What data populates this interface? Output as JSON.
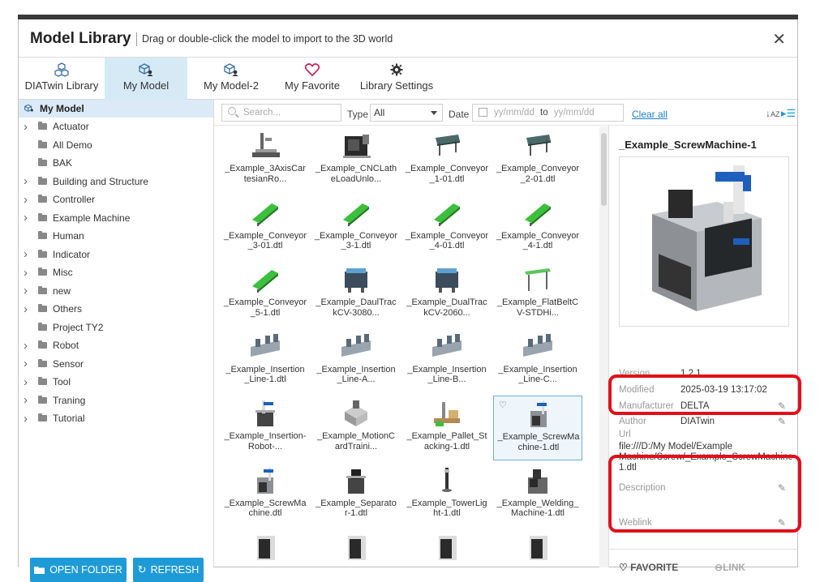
{
  "window": {
    "title": "Model Library",
    "subtitle": "Drag or double-click the model to import to the 3D world",
    "close_label": "✕"
  },
  "tabs": [
    {
      "label": "DIATwin Library",
      "icon": "cubes-icon"
    },
    {
      "label": "My Model",
      "icon": "cube-user-icon"
    },
    {
      "label": "My Model-2",
      "icon": "cube-user-icon"
    },
    {
      "label": "My Favorite",
      "icon": "heart-icon"
    },
    {
      "label": "Library Settings",
      "icon": "gear-icon"
    }
  ],
  "sidebar": {
    "root_label": "My Model",
    "items": [
      {
        "label": "Actuator",
        "expandable": true
      },
      {
        "label": "All Demo",
        "expandable": false
      },
      {
        "label": "BAK",
        "expandable": false
      },
      {
        "label": "Building and Structure",
        "expandable": true
      },
      {
        "label": "Controller",
        "expandable": true
      },
      {
        "label": "Example Machine",
        "expandable": true
      },
      {
        "label": "Human",
        "expandable": false
      },
      {
        "label": "Indicator",
        "expandable": true
      },
      {
        "label": "Misc",
        "expandable": true
      },
      {
        "label": "new",
        "expandable": true
      },
      {
        "label": "Others",
        "expandable": true
      },
      {
        "label": "Project TY2",
        "expandable": false
      },
      {
        "label": "Robot",
        "expandable": true
      },
      {
        "label": "Sensor",
        "expandable": true
      },
      {
        "label": "Tool",
        "expandable": true
      },
      {
        "label": "Traning",
        "expandable": true
      },
      {
        "label": "Tutorial",
        "expandable": true
      }
    ],
    "open_folder_label": "OPEN FOLDER",
    "refresh_label": "REFRESH"
  },
  "toolbar": {
    "search_placeholder": "Search...",
    "type_label": "Type",
    "type_value": "All",
    "date_label": "Date",
    "date_from_placeholder": "yy/mm/dd",
    "date_to_label": "to",
    "date_to_placeholder": "yy/mm/dd",
    "clear_all_label": "Clear all",
    "sort_label": "↓A Z"
  },
  "models": [
    {
      "name": "_Example_3AxisCartesianRo...",
      "line1": "_Example_3AxisCar",
      "line2": "tesianRo...",
      "kind": "gantry"
    },
    {
      "name": "_Example_CNCLatheLoadUnlo...",
      "line1": "_Example_CNCLath",
      "line2": "eLoadUnlo...",
      "kind": "cnc"
    },
    {
      "name": "_Example_Conveyor_1-01.dtl",
      "line1": "_Example_Conveyor",
      "line2": "_1-01.dtl",
      "kind": "conv-dark"
    },
    {
      "name": "_Example_Conveyor_2-01.dtl",
      "line1": "_Example_Conveyor",
      "line2": "_2-01.dtl",
      "kind": "conv-dark"
    },
    {
      "name": "_Example_Conveyor_3-01.dtl",
      "line1": "_Example_Conveyor",
      "line2": "_3-01.dtl",
      "kind": "conv-green"
    },
    {
      "name": "_Example_Conveyor_3-1.dtl",
      "line1": "_Example_Conveyor",
      "line2": "_3-1.dtl",
      "kind": "conv-green"
    },
    {
      "name": "_Example_Conveyor_4-01.dtl",
      "line1": "_Example_Conveyor",
      "line2": "_4-01.dtl",
      "kind": "conv-green"
    },
    {
      "name": "_Example_Conveyor_4-1.dtl",
      "line1": "_Example_Conveyor",
      "line2": "_4-1.dtl",
      "kind": "conv-green"
    },
    {
      "name": "_Example_Conveyor_5-1.dtl",
      "line1": "_Example_Conveyor",
      "line2": "_5-1.dtl",
      "kind": "conv-green"
    },
    {
      "name": "_Example_DaulTrackCV-3080...",
      "line1": "_Example_DaulTrac",
      "line2": "kCV-3080...",
      "kind": "dual"
    },
    {
      "name": "_Example_DualTrackCV-2060...",
      "line1": "_Example_DualTrac",
      "line2": "kCV-2060...",
      "kind": "dual"
    },
    {
      "name": "_Example_FlatBeltCV-STDHi...",
      "line1": "_Example_FlatBeltC",
      "line2": "V-STDHi...",
      "kind": "flat"
    },
    {
      "name": "_Example_Insertion_Line-1.dtl",
      "line1": "_Example_Insertion",
      "line2": "_Line-1.dtl",
      "kind": "line"
    },
    {
      "name": "_Example_Insertion_Line-A...",
      "line1": "_Example_Insertion",
      "line2": "_Line-A...",
      "kind": "line"
    },
    {
      "name": "_Example_Insertion_Line-B...",
      "line1": "_Example_Insertion",
      "line2": "_Line-B...",
      "kind": "line"
    },
    {
      "name": "_Example_Insertion_Line-C...",
      "line1": "_Example_Insertion",
      "line2": "_Line-C...",
      "kind": "line"
    },
    {
      "name": "_Example_Insertion-Robot-...",
      "line1": "_Example_Insertion-",
      "line2": "Robot-...",
      "kind": "robot"
    },
    {
      "name": "_Example_MotionCardTraini...",
      "line1": "_Example_MotionC",
      "line2": "ardTraini...",
      "kind": "motion"
    },
    {
      "name": "_Example_Pallet_Stacking-1.dtl",
      "line1": "_Example_Pallet_St",
      "line2": "acking-1.dtl",
      "kind": "pallet"
    },
    {
      "name": "_Example_ScrewMachine-1.dtl",
      "line1": "_Example_ScrewMa",
      "line2": "chine-1.dtl",
      "kind": "screw",
      "selected": true
    },
    {
      "name": "_Example_ScrewMachine.dtl",
      "line1": "_Example_ScrewMa",
      "line2": "chine.dtl",
      "kind": "screw"
    },
    {
      "name": "_Example_Separator-1.dtl",
      "line1": "_Example_Separato",
      "line2": "r-1.dtl",
      "kind": "separator"
    },
    {
      "name": "_Example_TowerLight-1.dtl",
      "line1": "_Example_TowerLig",
      "line2": "ht-1.dtl",
      "kind": "tower"
    },
    {
      "name": "_Example_Welding_Machine-1.dtl",
      "line1": "_Example_Welding_",
      "line2": "Machine-1.dtl",
      "kind": "welding"
    },
    {
      "name": "",
      "line1": "",
      "line2": "",
      "kind": "cabinet"
    },
    {
      "name": "",
      "line1": "",
      "line2": "",
      "kind": "cabinet"
    },
    {
      "name": "",
      "line1": "",
      "line2": "",
      "kind": "cabinet"
    },
    {
      "name": "",
      "line1": "",
      "line2": "",
      "kind": "cabinet"
    }
  ],
  "detail": {
    "title": "_Example_ScrewMachine-1",
    "version_label": "Version",
    "version_value": "1.2.1",
    "modified_label": "Modified",
    "modified_value": "2025-03-19 13:17:02",
    "manufacturer_label": "Manufacturer",
    "manufacturer_value": "DELTA",
    "author_label": "Author",
    "author_value": "DIATwin",
    "url_label": "Url",
    "url_value": "file:///D:/My Model/Example Machine/Screw/_Example_ScrewMachine-1.dtl",
    "description_label": "Description",
    "weblink_label": "Weblink",
    "favorite_label": "FAVORITE",
    "link_label": "LINK"
  },
  "colors": {
    "accent": "#1e9bd7",
    "selected_tab": "#d6eaf6",
    "highlight_box": "#e0101a",
    "conveyor_green": "#3cbf3c"
  }
}
